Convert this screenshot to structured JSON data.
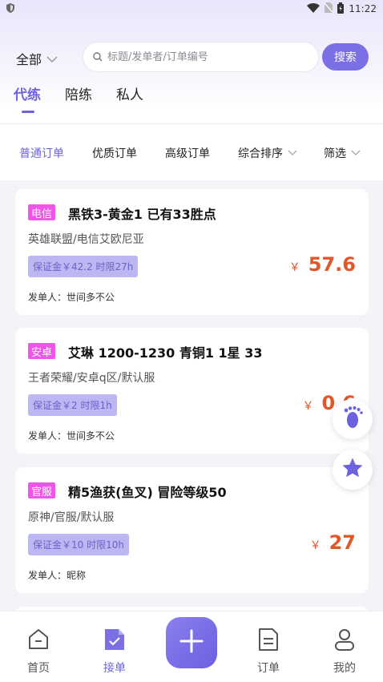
{
  "status_bar": {
    "time": "11:22"
  },
  "search": {
    "scope_label": "全部",
    "placeholder": "标题/发单者/订单编号",
    "button_label": "搜索"
  },
  "main_tabs": [
    {
      "label": "代练",
      "active": true
    },
    {
      "label": "陪练",
      "active": false
    },
    {
      "label": "私人",
      "active": false
    }
  ],
  "filters": [
    {
      "label": "普通订单",
      "active": true
    },
    {
      "label": "优质订单",
      "active": false
    },
    {
      "label": "高级订单",
      "active": false
    },
    {
      "label": "综合排序",
      "active": false,
      "dropdown": true
    },
    {
      "label": "筛选",
      "active": false,
      "dropdown": true
    }
  ],
  "orders": [
    {
      "tag": "电信",
      "title": "黑铁3-黄金1 已有33胜点",
      "subtitle": "英雄联盟/电信艾欧尼亚",
      "deposit": "保证金￥42.2 时限27h",
      "publisher": "发单人：世间多不公",
      "currency": "￥",
      "price": "57.6"
    },
    {
      "tag": "安卓",
      "title": "艾琳 1200-1230 青铜1 1星 33",
      "subtitle": "王者荣耀/安卓q区/默认服",
      "deposit": "保证金￥2 时限1h",
      "publisher": "发单人：世间多不公",
      "currency": "￥",
      "price": "0.6"
    },
    {
      "tag": "官服",
      "title": "精5渔获(鱼叉) 冒险等级50",
      "subtitle": "原神/官服/默认服",
      "deposit": "保证金￥10 时限10h",
      "publisher": "发单人：昵称",
      "currency": "￥",
      "price": "27"
    }
  ],
  "bottom_nav": [
    {
      "label": "首页",
      "icon": "home-icon",
      "active": false
    },
    {
      "label": "接单",
      "icon": "order-take-icon",
      "active": true
    },
    {
      "label": "订单",
      "icon": "order-list-icon",
      "active": false
    },
    {
      "label": "我的",
      "icon": "profile-icon",
      "active": false
    }
  ],
  "colors": {
    "accent": "#6d63df",
    "tag": "#ee55e8",
    "price": "#e2572a",
    "deposit_bg": "#bcb6f2"
  }
}
